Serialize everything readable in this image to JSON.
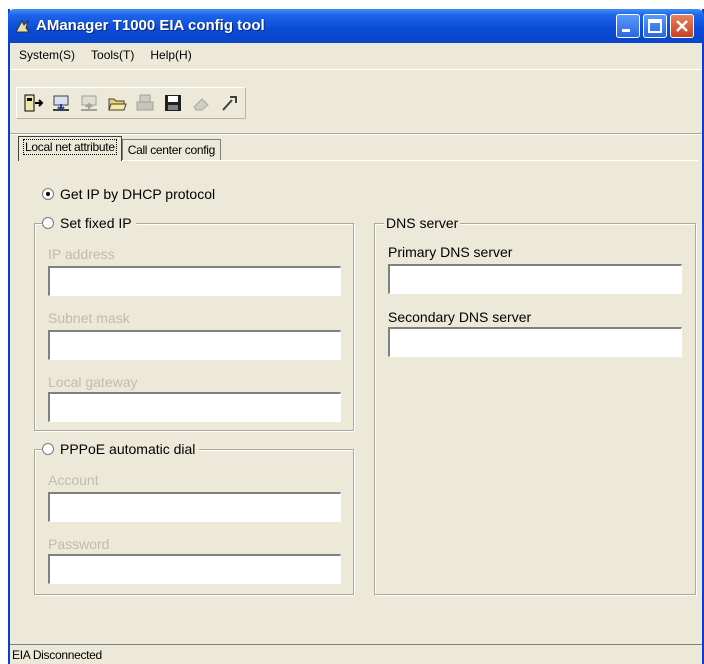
{
  "window": {
    "title": "AManager T1000 EIA config tool"
  },
  "menu": [
    "System(S)",
    "Tools(T)",
    "Help(H)"
  ],
  "toolbar": {
    "icons": [
      "connect-icon",
      "download-config-icon",
      "upload-config-icon",
      "open-folder-icon",
      "print-icon",
      "save-icon",
      "erase-icon",
      "tool-icon"
    ]
  },
  "tabs": [
    "Local net attribute",
    "Call center config"
  ],
  "network": {
    "dhcp_label": "Get IP by DHCP protocol",
    "dhcp_selected": true,
    "fixed_ip_label": "Set fixed IP",
    "ip_address_label": "IP address",
    "ip_address_value": "",
    "subnet_mask_label": "Subnet mask",
    "subnet_mask_value": "",
    "gateway_label": "Local gateway",
    "gateway_value": "",
    "pppoe_label": "PPPoE automatic dial",
    "account_label": "Account",
    "account_value": "",
    "password_label": "Password",
    "password_value": ""
  },
  "dns": {
    "title": "DNS server",
    "primary_label": "Primary DNS server",
    "primary_value": "",
    "secondary_label": "Secondary DNS server",
    "secondary_value": ""
  },
  "status": {
    "text": "EIA Disconnected"
  }
}
